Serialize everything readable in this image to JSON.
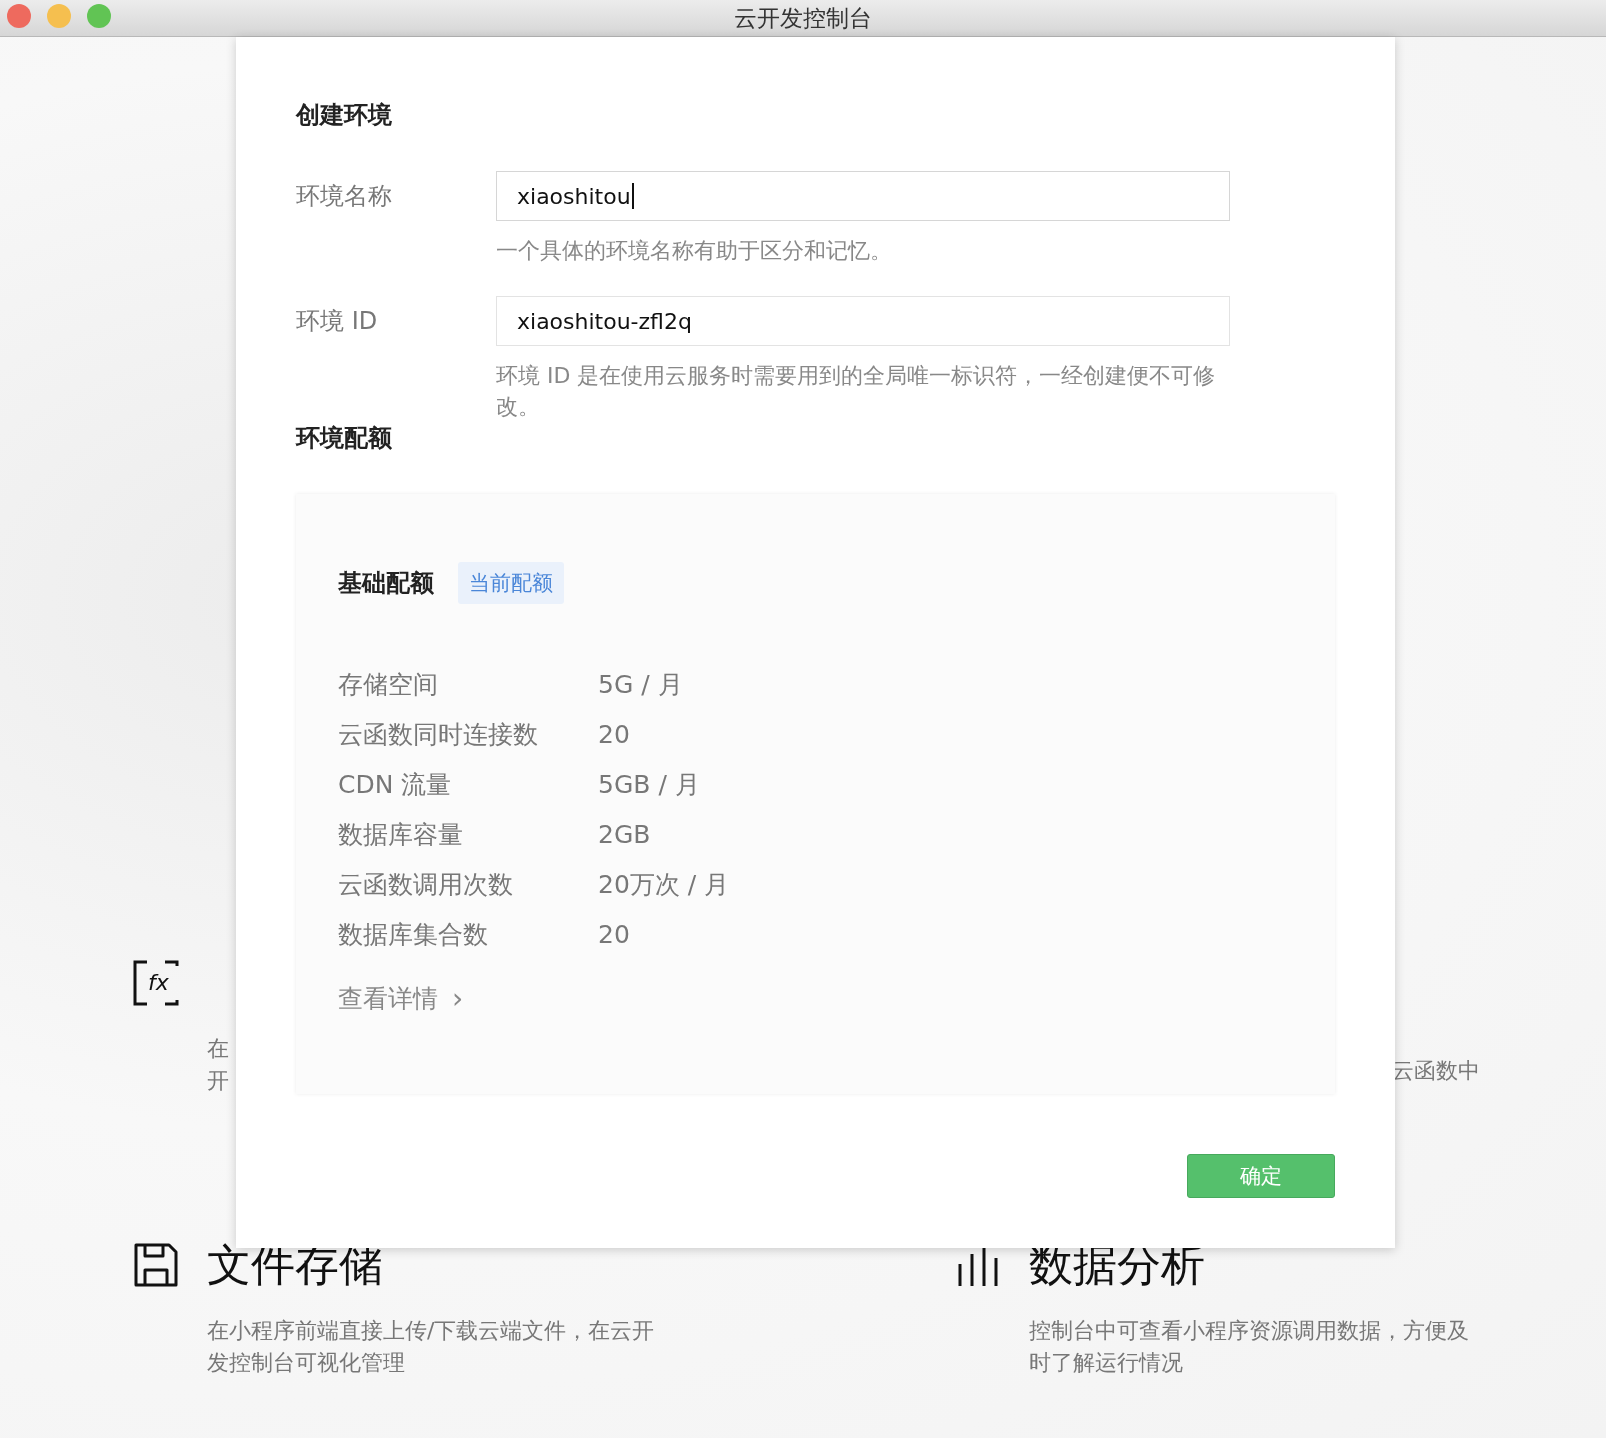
{
  "window": {
    "title": "云开发控制台"
  },
  "background": {
    "features": [
      {
        "kind": "function",
        "icon_text": "fx",
        "lines": [
          "在",
          "开"
        ]
      },
      {
        "kind": "note",
        "lines": [
          "云函数中"
        ]
      },
      {
        "kind": "storage",
        "title": "文件存储",
        "lines": [
          "在小程序前端直接上传/下载云端文件，在云开",
          "发控制台可视化管理"
        ]
      },
      {
        "kind": "analytics",
        "title": "数据分析",
        "lines": [
          "控制台中可查看小程序资源调用数据，方便及",
          "时了解运行情况"
        ]
      }
    ]
  },
  "dialog": {
    "title": "创建环境",
    "fields": [
      {
        "label": "环境名称",
        "value": "xiaoshitou",
        "focused": true,
        "hint": "一个具体的环境名称有助于区分和记忆。"
      },
      {
        "label": "环境 ID",
        "value": "xiaoshitou-zfl2q",
        "focused": false,
        "hint": "环境 ID 是在使用云服务时需要用到的全局唯一标识符，一经创建便不可修改。"
      }
    ],
    "quota_heading": "环境配额",
    "quota": {
      "title": "基础配额",
      "badge": "当前配额",
      "rows": [
        {
          "label": "存储空间",
          "value": "5G / 月"
        },
        {
          "label": "云函数同时连接数",
          "value": "20"
        },
        {
          "label": "CDN 流量",
          "value": "5GB / 月"
        },
        {
          "label": "数据库容量",
          "value": "2GB"
        },
        {
          "label": "云函数调用次数",
          "value": "20万次 / 月"
        },
        {
          "label": "数据库集合数",
          "value": "20"
        }
      ],
      "details_link": "查看详情",
      "details_arrow": "›"
    },
    "confirm_button": "确定"
  }
}
